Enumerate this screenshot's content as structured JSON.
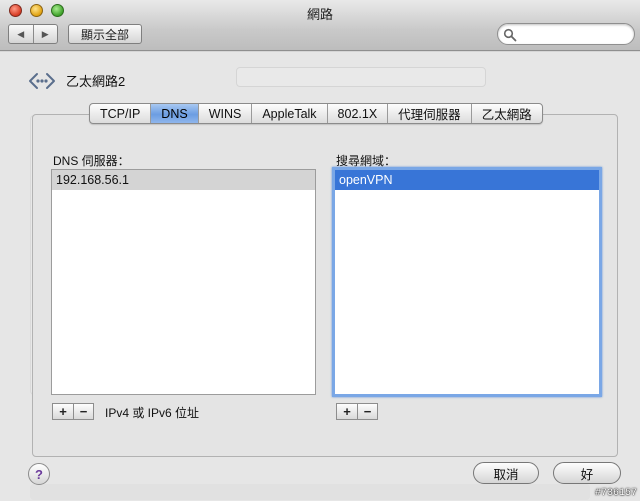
{
  "window": {
    "title": "網路"
  },
  "toolbar": {
    "back_icon": "◀",
    "forward_icon": "▶",
    "show_all_label": "顯示全部",
    "search_placeholder": ""
  },
  "service": {
    "name": "乙太網路2"
  },
  "tabs": [
    {
      "label": "TCP/IP",
      "active": false
    },
    {
      "label": "DNS",
      "active": true
    },
    {
      "label": "WINS",
      "active": false
    },
    {
      "label": "AppleTalk",
      "active": false
    },
    {
      "label": "802.1X",
      "active": false
    },
    {
      "label": "代理伺服器",
      "active": false
    },
    {
      "label": "乙太網路",
      "active": false
    }
  ],
  "dns": {
    "label": "DNS 伺服器：",
    "servers": [
      "192.168.56.1"
    ],
    "add_label": "+",
    "remove_label": "−",
    "hint": "IPv4 或 IPv6 位址"
  },
  "search_domains": {
    "label": "搜尋網域：",
    "domains": [
      "openVPN"
    ],
    "add_label": "+",
    "remove_label": "−"
  },
  "footer": {
    "help_label": "?",
    "cancel_label": "取消",
    "ok_label": "好"
  },
  "watermark": "#736157",
  "colors": {
    "selection": "#3875d7",
    "tab_active": "#6c9de2",
    "focus_ring": "#7aa7e6"
  }
}
